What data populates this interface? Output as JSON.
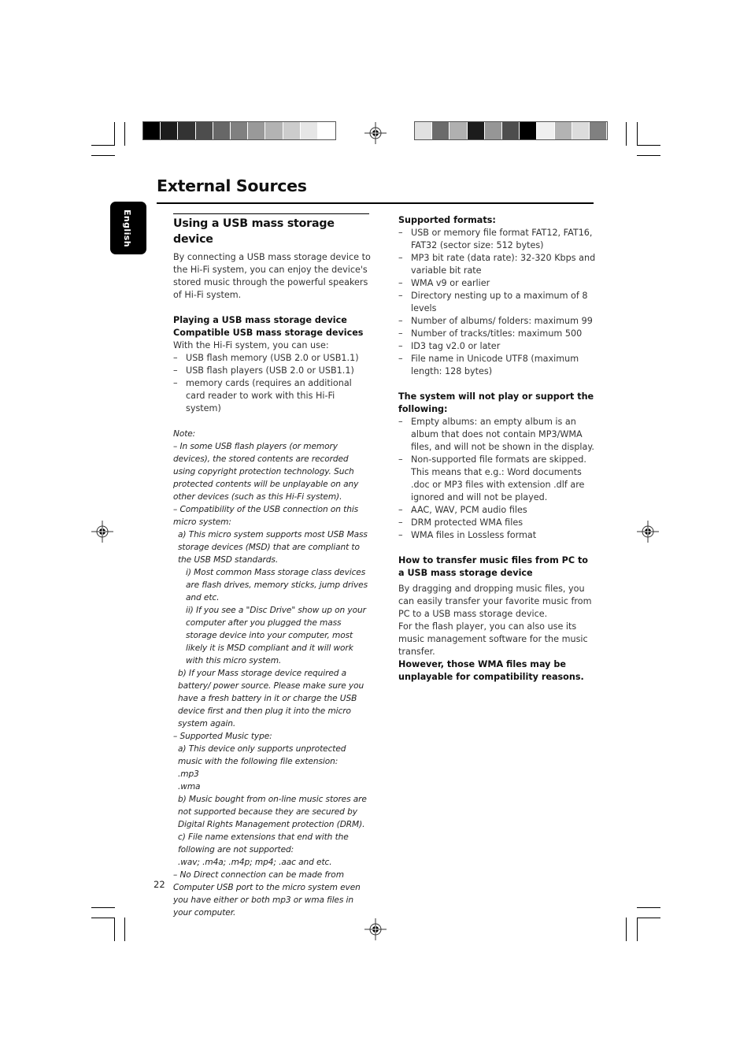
{
  "page": {
    "title": "External Sources",
    "language_tab": "English",
    "page_number": "22"
  },
  "swatches": {
    "left": [
      "#000000",
      "#1c1c1c",
      "#333333",
      "#4d4d4d",
      "#676767",
      "#808080",
      "#999999",
      "#b3b3b3",
      "#cccccc",
      "#e6e6e6",
      "#ffffff"
    ],
    "right": [
      "#e0e0e0",
      "#6b6b6b",
      "#b0b0b0",
      "#1c1c1c",
      "#969696",
      "#4d4d4d",
      "#000000",
      "#f0f0f0",
      "#b3b3b3",
      "#dcdcdc",
      "#808080"
    ]
  },
  "left_column": {
    "section_title": "Using a USB mass storage device",
    "intro": "By connecting a USB mass storage device to the Hi-Fi system, you can enjoy the device's stored music through the powerful speakers of Hi-Fi system.",
    "playing_heading": "Playing a USB mass storage device",
    "compatible_heading": "Compatible USB mass storage devices",
    "compatible_intro": "With the Hi-Fi system, you can use:",
    "compatible_items": [
      "USB flash memory (USB 2.0 or USB1.1)",
      "USB flash players (USB 2.0 or USB1.1)",
      "memory cards (requires an additional card reader to work with this Hi-Fi system)"
    ],
    "note": {
      "label": "Note:",
      "p1": "–  In some USB flash players (or memory devices), the stored contents are recorded using copyright protection technology. Such protected contents will be unplayable on any other devices (such as this Hi-Fi system).",
      "p2": "–  Compatibility of the USB connection on this micro system:",
      "p2a": "a) This micro system supports most USB Mass storage devices (MSD) that are compliant to the USB MSD standards.",
      "p2a_i": "i) Most common Mass storage class devices are flash drives, memory sticks, jump drives and etc.",
      "p2a_ii": "ii) If you see a \"Disc Drive\" show up on your computer after you plugged the mass storage device into your computer, most likely it is MSD compliant and it will work with this micro system.",
      "p2b": "b) If your Mass storage device required a battery/ power source. Please make sure you have a fresh battery in it or charge the USB device first and then plug it into the micro system again.",
      "p3": "–  Supported Music type:",
      "p3a": "a) This device only supports unprotected music with the following file extension:",
      "ext1": ".mp3",
      "ext2": ".wma",
      "p3b": "b) Music bought from on-line music stores are not supported because they are secured by Digital Rights Management protection (DRM).",
      "p3c": "c) File name extensions that end with the following are not supported:",
      "p3c_list": ".wav; .m4a; .m4p; mp4; .aac and etc.",
      "p4": "–  No Direct connection can be made from Computer USB port to the micro system even you have either or both mp3 or wma files in your computer."
    }
  },
  "right_column": {
    "formats_heading": "Supported formats:",
    "formats": [
      "USB or memory file format FAT12, FAT16, FAT32 (sector size: 512 bytes)",
      "MP3 bit rate (data rate): 32-320 Kbps and variable bit rate",
      "WMA v9 or earlier",
      "Directory nesting up to a maximum of 8 levels",
      "Number of albums/ folders: maximum 99",
      "Number of tracks/titles: maximum 500",
      "ID3 tag v2.0 or later",
      "File name in Unicode UTF8 (maximum length: 128 bytes)"
    ],
    "not_supported_heading": "The system will not play or support the following:",
    "not_supported": [
      "Empty albums: an empty album is an album that does not contain MP3/WMA files, and will not be shown in the display.",
      "Non-supported file formats are skipped. This means that e.g.: Word documents .doc or MP3 files with extension .dlf are ignored and will not be played.",
      "AAC, WAV, PCM audio files",
      "DRM protected WMA files",
      "WMA files in Lossless format"
    ],
    "transfer_heading": "How to transfer music files from PC to a USB mass storage device",
    "transfer_p1": "By dragging and dropping music files, you can easily transfer your favorite music from PC to a USB mass storage device.",
    "transfer_p2": "For the flash player, you can also use its music management software for the music transfer.",
    "transfer_warning": "However, those WMA files may be unplayable for compatibility reasons."
  }
}
